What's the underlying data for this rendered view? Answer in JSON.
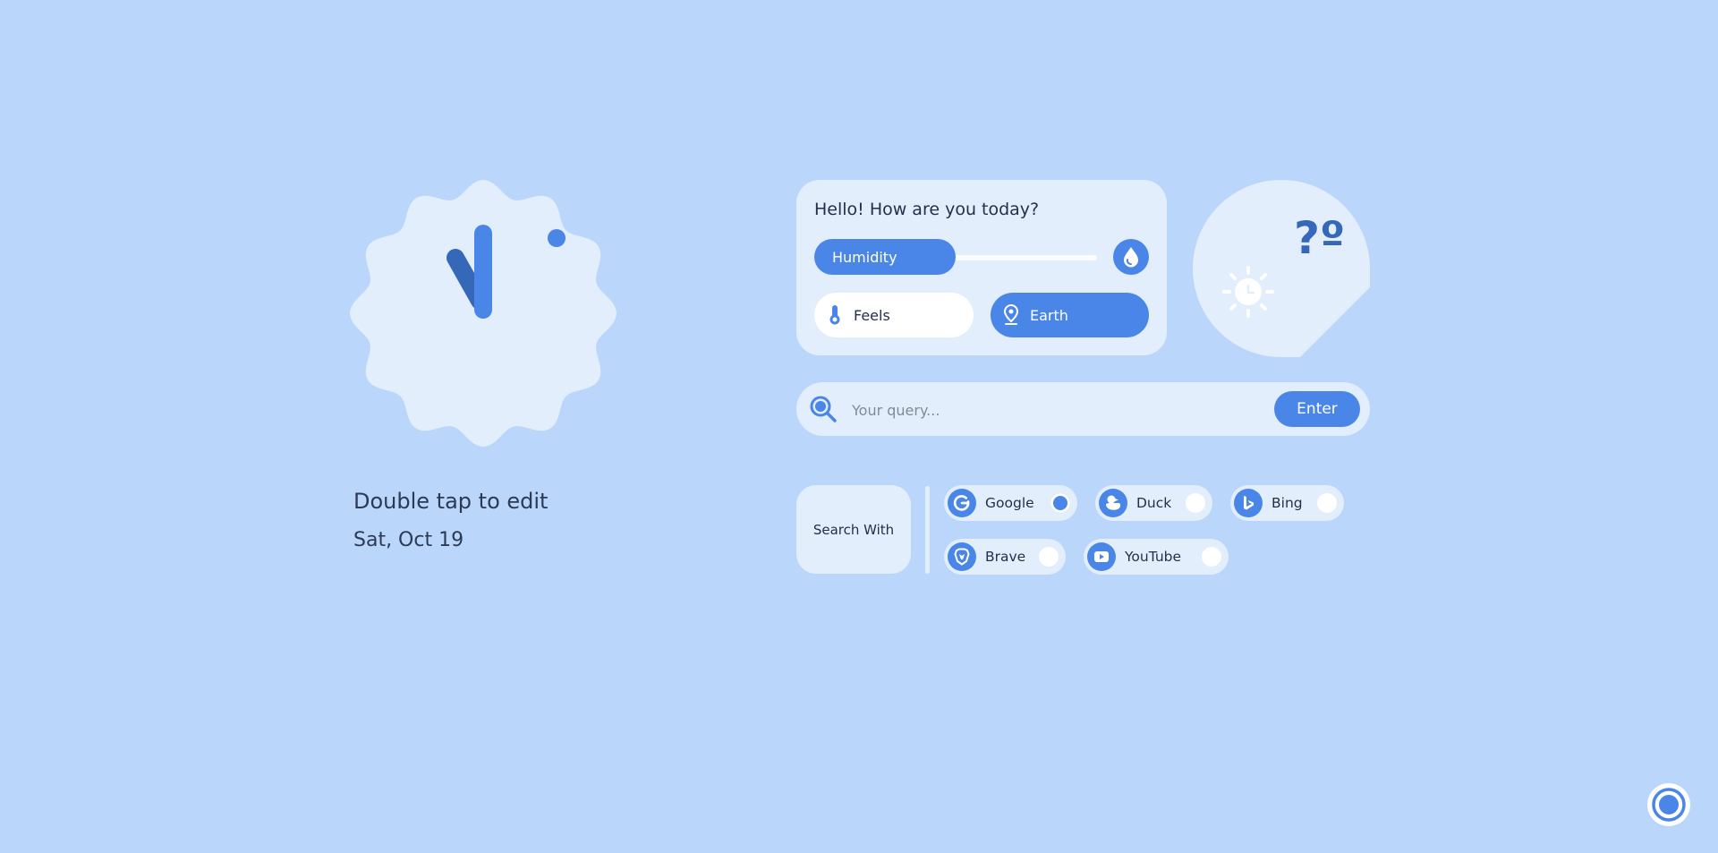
{
  "clock": {
    "hint": "Double tap to edit",
    "date": "Sat, Oct 19"
  },
  "weather": {
    "greeting": "Hello! How are you today?",
    "humidity_label": "Humidity",
    "feels_label": "Feels",
    "location_label": "Earth",
    "temperature": "?º"
  },
  "search": {
    "placeholder": "Your query...",
    "enter_label": "Enter",
    "search_with_label": "Search With"
  },
  "engines": [
    {
      "name": "Google",
      "icon": "google-icon",
      "selected": true
    },
    {
      "name": "Duck",
      "icon": "duck-icon",
      "selected": false
    },
    {
      "name": "Bing",
      "icon": "bing-icon",
      "selected": false
    },
    {
      "name": "Brave",
      "icon": "brave-icon",
      "selected": false
    },
    {
      "name": "YouTube",
      "icon": "youtube-icon",
      "selected": false
    }
  ],
  "colors": {
    "background": "#bbd6fb",
    "card": "#e3eefc",
    "accent": "#4a86e8"
  }
}
